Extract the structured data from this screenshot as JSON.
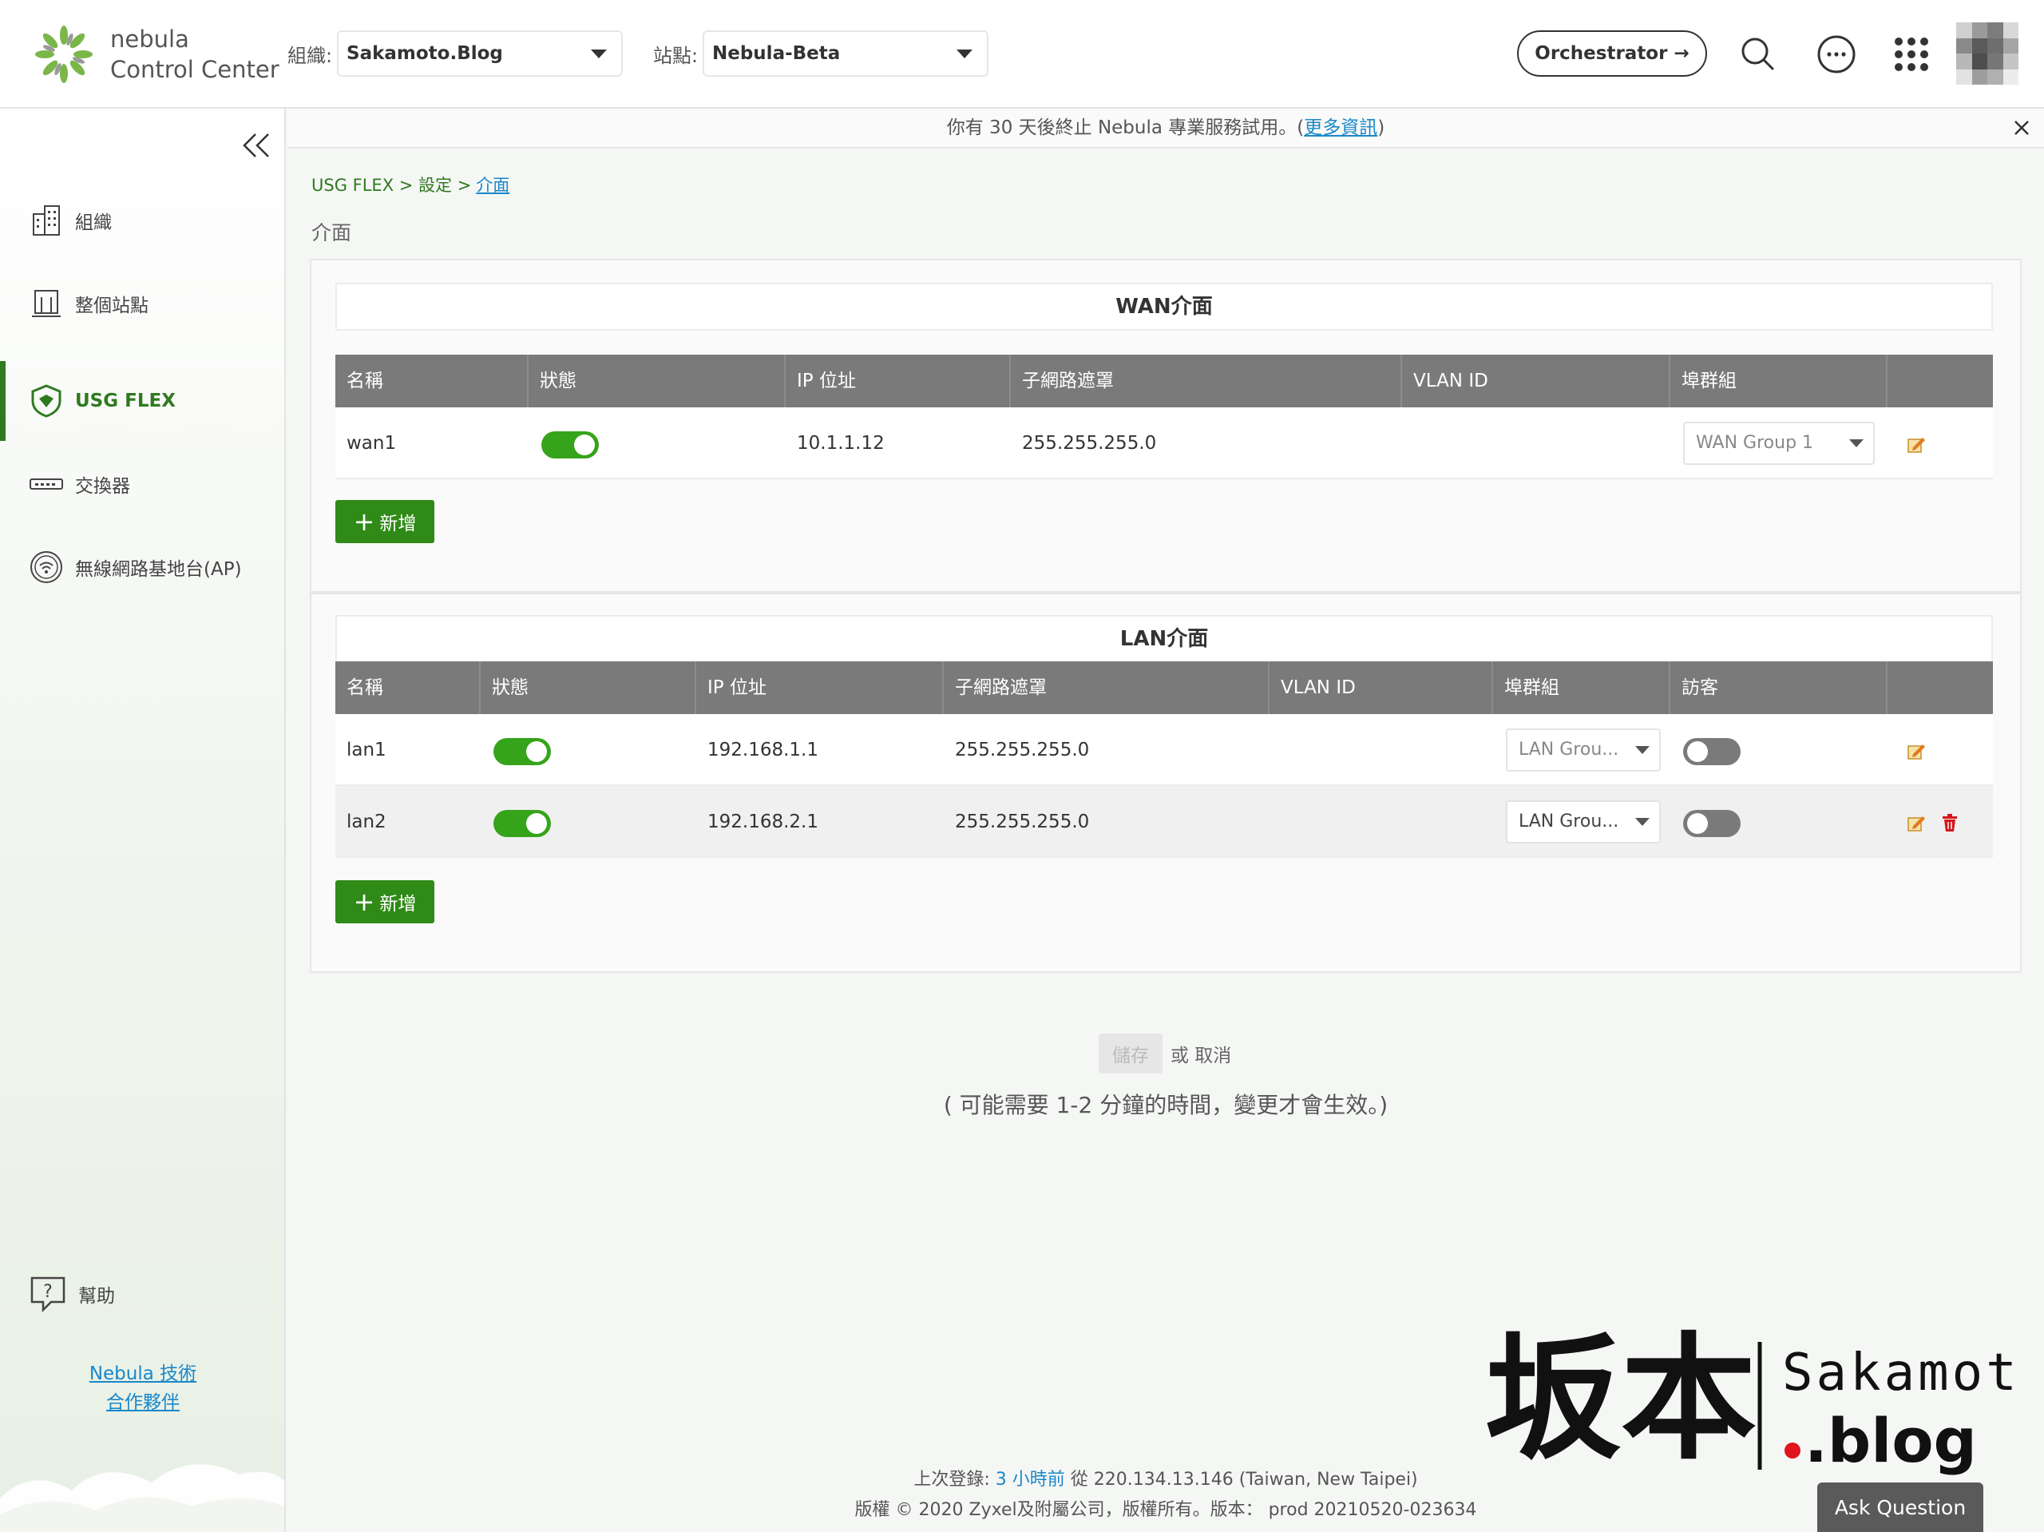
{
  "app": {
    "brand_line1": "nebula",
    "brand_line2": "Control Center"
  },
  "header": {
    "org_label": "組織:",
    "org_value": "Sakamoto.Blog",
    "site_label": "站點:",
    "site_value": "Nebula-Beta",
    "orchestrator_label": "Orchestrator →"
  },
  "sidebar": {
    "items": [
      {
        "label": "組織",
        "icon": "building-icon"
      },
      {
        "label": "整個站點",
        "icon": "site-icon"
      },
      {
        "label": "USG FLEX",
        "icon": "shield-icon",
        "active": true
      },
      {
        "label": "交換器",
        "icon": "switch-icon"
      },
      {
        "label": "無線網路基地台(AP)",
        "icon": "wifi-icon"
      }
    ],
    "help_label": "幫助",
    "partner_line1": "Nebula 技術",
    "partner_line2": "合作夥伴"
  },
  "banner": {
    "text": "你有 30 天後終止 Nebula 專業服務試用。(",
    "link": "更多資訊",
    "suffix": ")"
  },
  "breadcrumb": {
    "part1": "USG FLEX > 設定 >",
    "current": "介面"
  },
  "page": {
    "title": "介面"
  },
  "wan": {
    "title": "WAN介面",
    "columns": [
      "名稱",
      "狀態",
      "IP 位址",
      "子網路遮罩",
      "VLAN ID",
      "埠群組"
    ],
    "rows": [
      {
        "name": "wan1",
        "enabled": true,
        "ip": "10.1.1.12",
        "mask": "255.255.255.0",
        "vlan": "",
        "group": "WAN Group 1"
      }
    ],
    "add_label": "新增"
  },
  "lan": {
    "title": "LAN介面",
    "columns": [
      "名稱",
      "狀態",
      "IP 位址",
      "子網路遮罩",
      "VLAN ID",
      "埠群組",
      "訪客"
    ],
    "rows": [
      {
        "name": "lan1",
        "enabled": true,
        "ip": "192.168.1.1",
        "mask": "255.255.255.0",
        "vlan": "",
        "group": "LAN Grou...",
        "guest": false
      },
      {
        "name": "lan2",
        "enabled": true,
        "ip": "192.168.2.1",
        "mask": "255.255.255.0",
        "vlan": "",
        "group": "LAN Grou...",
        "guest": false
      }
    ],
    "add_label": "新增"
  },
  "actions": {
    "save_label": "儲存",
    "or_cancel": "或 取消",
    "note": "( 可能需要 1-2 分鐘的時間，變更才會生效。)"
  },
  "footer": {
    "last_login_prefix": "上次登錄:",
    "last_login_time": "3 小時前",
    "last_login_suffix": "從 220.134.13.146 (Taiwan, New Taipei)",
    "copyright": "版權 © 2020 Zyxel及附屬公司，版權所有。版本： prod 20210520-023634"
  },
  "watermark": {
    "cjk": "坂本",
    "line1": "Sakamoto",
    "line2": ".blog"
  },
  "ask_question_label": "Ask Question",
  "colors": {
    "accent_green": "#2f8a17",
    "toggle_on": "#35a41a",
    "link_blue": "#1a88c9",
    "table_header": "#7a7a7a"
  }
}
